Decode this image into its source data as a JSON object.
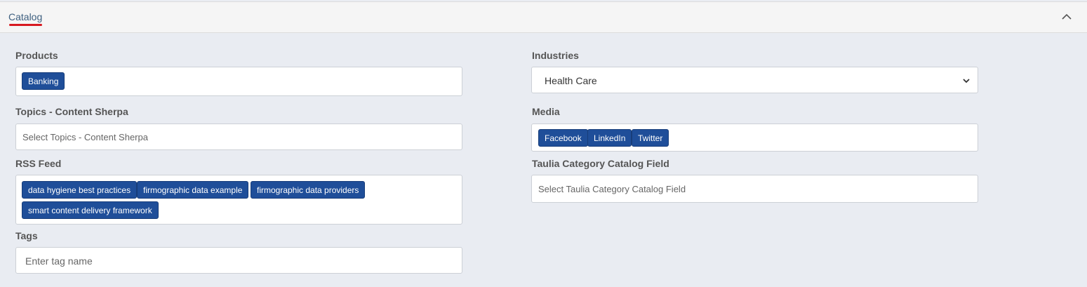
{
  "panel": {
    "title": "Catalog",
    "accent_color": "#d71920",
    "collapse_icon": "chevron-up-icon"
  },
  "products": {
    "label": "Products",
    "tags": [
      "Banking"
    ]
  },
  "industries": {
    "label": "Industries",
    "selected": "Health Care"
  },
  "topics": {
    "label": "Topics - Content Sherpa",
    "placeholder": "Select Topics - Content Sherpa"
  },
  "media": {
    "label": "Media",
    "tags": [
      "Facebook",
      "LinkedIn",
      "Twitter"
    ]
  },
  "rss": {
    "label": "RSS Feed",
    "tags": [
      "data hygiene best practices",
      "firmographic data example",
      "firmographic data providers",
      "smart content delivery framework"
    ]
  },
  "taulia": {
    "label": "Taulia Category Catalog Field",
    "placeholder": "Select Taulia Category Catalog Field"
  },
  "tags_field": {
    "label": "Tags",
    "placeholder": "Enter tag name"
  },
  "colors": {
    "tag_bg": "#1f4e99",
    "background": "#e9ecf2"
  }
}
